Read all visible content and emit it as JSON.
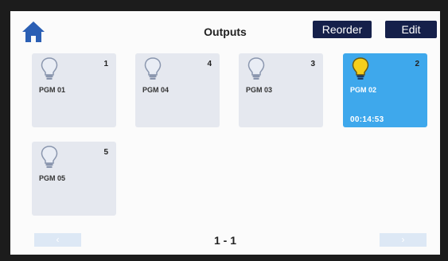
{
  "header": {
    "title": "Outputs",
    "reorder_label": "Reorder",
    "edit_label": "Edit",
    "home_icon": "home-icon"
  },
  "outputs": [
    {
      "number": "1",
      "label": "PGM 01",
      "state": "off",
      "timer": ""
    },
    {
      "number": "4",
      "label": "PGM 04",
      "state": "off",
      "timer": ""
    },
    {
      "number": "3",
      "label": "PGM 03",
      "state": "off",
      "timer": ""
    },
    {
      "number": "2",
      "label": "PGM 02",
      "state": "on",
      "timer": "00:14:53"
    },
    {
      "number": "5",
      "label": "PGM 05",
      "state": "off",
      "timer": ""
    }
  ],
  "pagination": {
    "indicator": "1 - 1",
    "prev_glyph": "‹",
    "next_glyph": "›"
  },
  "colors": {
    "accent_button": "#15204a",
    "active_tile": "#3ea8ec",
    "inactive_tile": "#e5e8ef",
    "bulb_off": "#aab4c8",
    "bulb_on": "#f5cf1c",
    "home_icon": "#2b5fb4"
  }
}
